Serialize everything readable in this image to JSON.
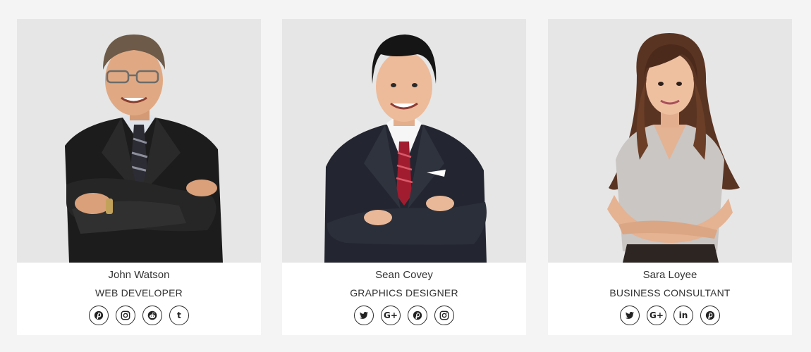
{
  "team": [
    {
      "name": "John Watson",
      "role": "WEB DEVELOPER",
      "photo": "man-arms-crossed-glasses",
      "social": [
        {
          "icon": "pinterest-icon"
        },
        {
          "icon": "instagram-icon"
        },
        {
          "icon": "reddit-icon"
        },
        {
          "icon": "tumblr-icon"
        }
      ]
    },
    {
      "name": "Sean Covey",
      "role": "GRAPHICS DESIGNER",
      "photo": "young-man-suit-red-tie",
      "social": [
        {
          "icon": "twitter-icon"
        },
        {
          "icon": "google-plus-icon",
          "text": "G+"
        },
        {
          "icon": "pinterest-icon"
        },
        {
          "icon": "instagram-icon"
        }
      ]
    },
    {
      "name": "Sara Loyee",
      "role": "BUSINESS CONSULTANT",
      "photo": "woman-arms-crossed-blouse",
      "social": [
        {
          "icon": "twitter-icon"
        },
        {
          "icon": "google-plus-icon",
          "text": "G+"
        },
        {
          "icon": "linkedin-icon",
          "text": "in"
        },
        {
          "icon": "pinterest-icon"
        }
      ]
    }
  ],
  "colors": {
    "page_background": "#f4f4f4",
    "photo_background": "#e6e6e6",
    "card_background": "#ffffff",
    "text": "#333333"
  }
}
